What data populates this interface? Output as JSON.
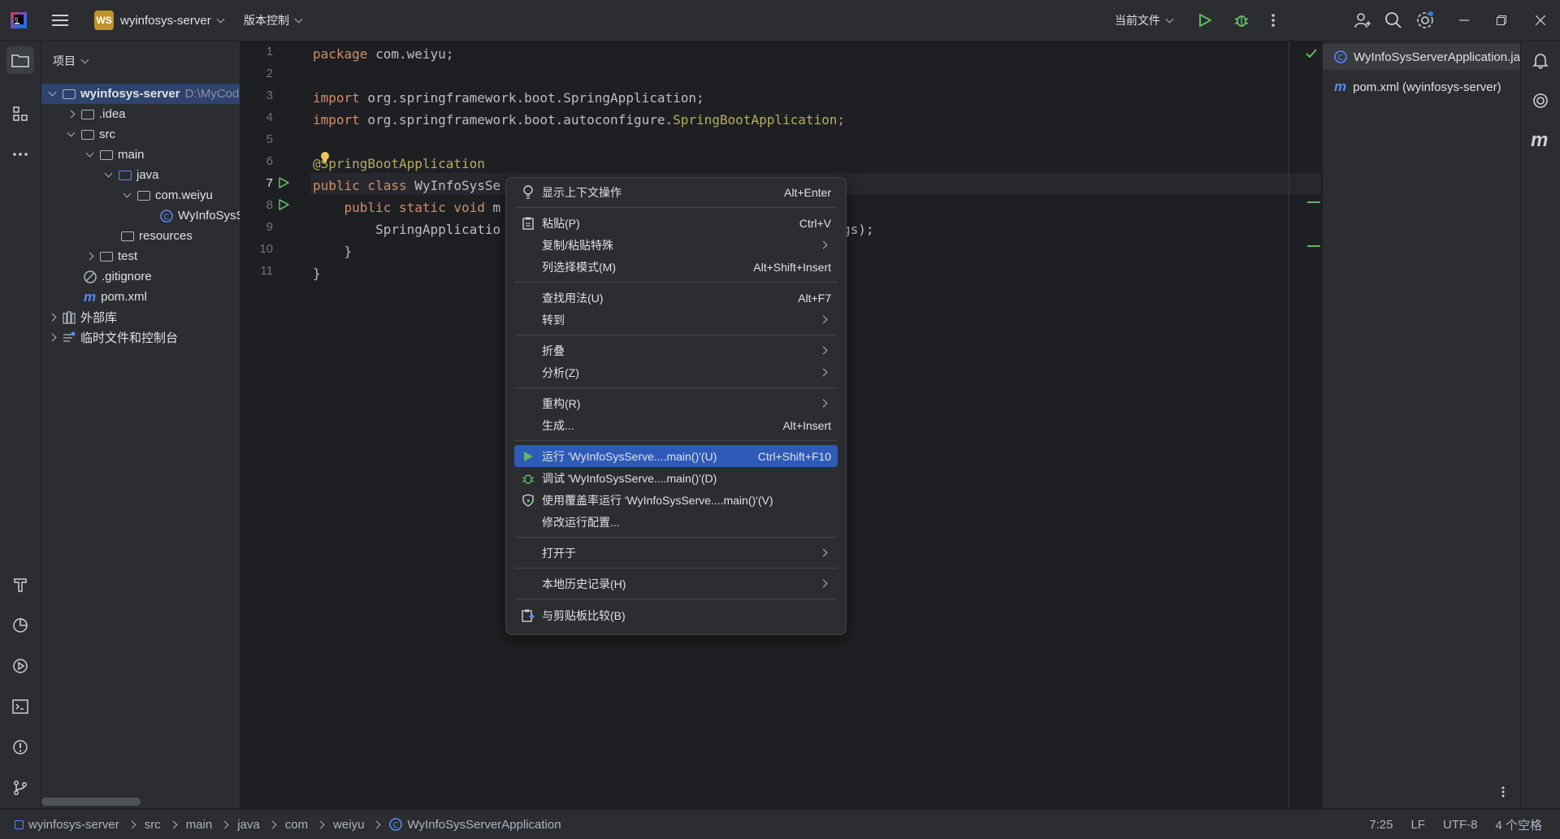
{
  "titlebar": {
    "project_badge": "WS",
    "project_name": "wyinfosys-server",
    "vcs": "版本控制",
    "run_config": "当前文件"
  },
  "project_panel": {
    "title": "项目",
    "tree": [
      {
        "label": "wyinfosys-server",
        "extra": "D:\\MyCod",
        "bold": true
      },
      {
        "label": ".idea"
      },
      {
        "label": "src"
      },
      {
        "label": "main"
      },
      {
        "label": "java"
      },
      {
        "label": "com.weiyu"
      },
      {
        "label": "WyInfoSysS"
      },
      {
        "label": "resources"
      },
      {
        "label": "test"
      },
      {
        "label": ".gitignore"
      },
      {
        "label": "pom.xml"
      },
      {
        "label": "外部库"
      },
      {
        "label": "临时文件和控制台"
      }
    ]
  },
  "editor": {
    "line_numbers": [
      "1",
      "2",
      "3",
      "4",
      "5",
      "6",
      "7",
      "8",
      "9",
      "10",
      "11"
    ],
    "lines": {
      "l1_kw": "package",
      "l1_rest": " com.weiyu;",
      "l3_kw": "import",
      "l3_rest": " org.springframework.boot.SpringApplication;",
      "l4_kw": "import",
      "l4_rest": " org.springframework.boot.autoconfigure.",
      "l4_cls": "SpringBootApplication",
      "l4_end": ";",
      "l6": "@SpringBootApplication",
      "l7_kw": "public class",
      "l7_rest": " WyInfoSysSe",
      "l8_kw": "    public static void",
      "l8_rest": " m",
      "l9": "        SpringApplicatio",
      "l9_tail": "gs);",
      "l10": "    }",
      "l11": "}"
    }
  },
  "right_panel": {
    "files": [
      "WyInfoSysServerApplication.ja",
      "pom.xml (wyinfosys-server)"
    ]
  },
  "context_menu": {
    "items": [
      {
        "label": "显示上下文操作",
        "shortcut": "Alt+Enter",
        "icon": "bulb-icon"
      },
      {
        "label": "粘贴(P)",
        "shortcut": "Ctrl+V",
        "icon": "clipboard-icon"
      },
      {
        "label": "复制/粘贴特殊",
        "submenu": true
      },
      {
        "label": "列选择模式(M)",
        "shortcut": "Alt+Shift+Insert"
      },
      {
        "label": "查找用法(U)",
        "shortcut": "Alt+F7"
      },
      {
        "label": "转到",
        "submenu": true
      },
      {
        "label": "折叠",
        "submenu": true
      },
      {
        "label": "分析(Z)",
        "submenu": true
      },
      {
        "label": "重构(R)",
        "submenu": true
      },
      {
        "label": "生成...",
        "shortcut": "Alt+Insert"
      },
      {
        "label": "运行 'WyInfoSysServe....main()'(U)",
        "shortcut": "Ctrl+Shift+F10",
        "icon": "run-icon",
        "highlight": true
      },
      {
        "label": "调试 'WyInfoSysServe....main()'(D)",
        "icon": "debug-icon"
      },
      {
        "label": "使用覆盖率运行 'WyInfoSysServe....main()'(V)",
        "icon": "coverage-icon"
      },
      {
        "label": "修改运行配置..."
      },
      {
        "label": "打开于",
        "submenu": true
      },
      {
        "label": "本地历史记录(H)",
        "submenu": true
      },
      {
        "label": "与剪贴板比较(B)",
        "icon": "compare-clipboard-icon"
      }
    ]
  },
  "statusbar": {
    "breadcrumb": [
      "wyinfosys-server",
      "src",
      "main",
      "java",
      "com",
      "weiyu",
      "WyInfoSysServerApplication"
    ],
    "position": "7:25",
    "line_sep": "LF",
    "encoding": "UTF-8",
    "indent": "4 个空格"
  },
  "colors": {
    "accent": "#2e5bb8",
    "run_green": "#5fb865",
    "keyword": "#cf8e6d",
    "annotation": "#b3ae60"
  }
}
